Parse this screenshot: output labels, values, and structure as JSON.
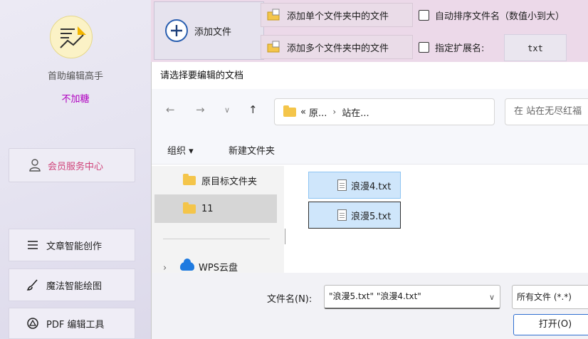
{
  "sidebar": {
    "app_name": "首助编辑高手",
    "subtitle": "不加糖",
    "member_center": "会员服务中心",
    "nav": [
      {
        "label": "文章智能创作",
        "icon": "menu-lines-icon"
      },
      {
        "label": "魔法智能绘图",
        "icon": "brush-icon"
      },
      {
        "label": "PDF 编辑工具",
        "icon": "pdf-icon"
      }
    ]
  },
  "toolbar": {
    "add_file": "添加文件",
    "add_single_folder": "添加单个文件夹中的文件",
    "add_multi_folder": "添加多个文件夹中的文件",
    "auto_sort": "自动排序文件名（数值小到大）",
    "specify_ext": "指定扩展名:",
    "ext_value": "txt"
  },
  "dialog": {
    "title": "请选择要编辑的文档",
    "breadcrumb_prefix": "«",
    "breadcrumb": [
      "原...",
      "站在..."
    ],
    "search_placeholder": "在 站在无尽红福",
    "organize": "组织 ▾",
    "new_folder": "新建文件夹",
    "tree": [
      {
        "label": "原目标文件夹"
      },
      {
        "label": "11"
      }
    ],
    "cloud": "WPS云盘",
    "files": [
      {
        "name": "浪漫4.txt"
      },
      {
        "name": "浪漫5.txt"
      }
    ],
    "filename_label": "文件名(N):",
    "filename_value": "\"浪漫5.txt\" \"浪漫4.txt\"",
    "filetype": "所有文件 (*.*)",
    "open": "打开(O)"
  },
  "colors": {
    "accent": "#2f6fd1",
    "subtitle": "#b000c0",
    "member": "#d0447a",
    "selection": "#cfe6fb",
    "folder": "#f4c54a"
  }
}
